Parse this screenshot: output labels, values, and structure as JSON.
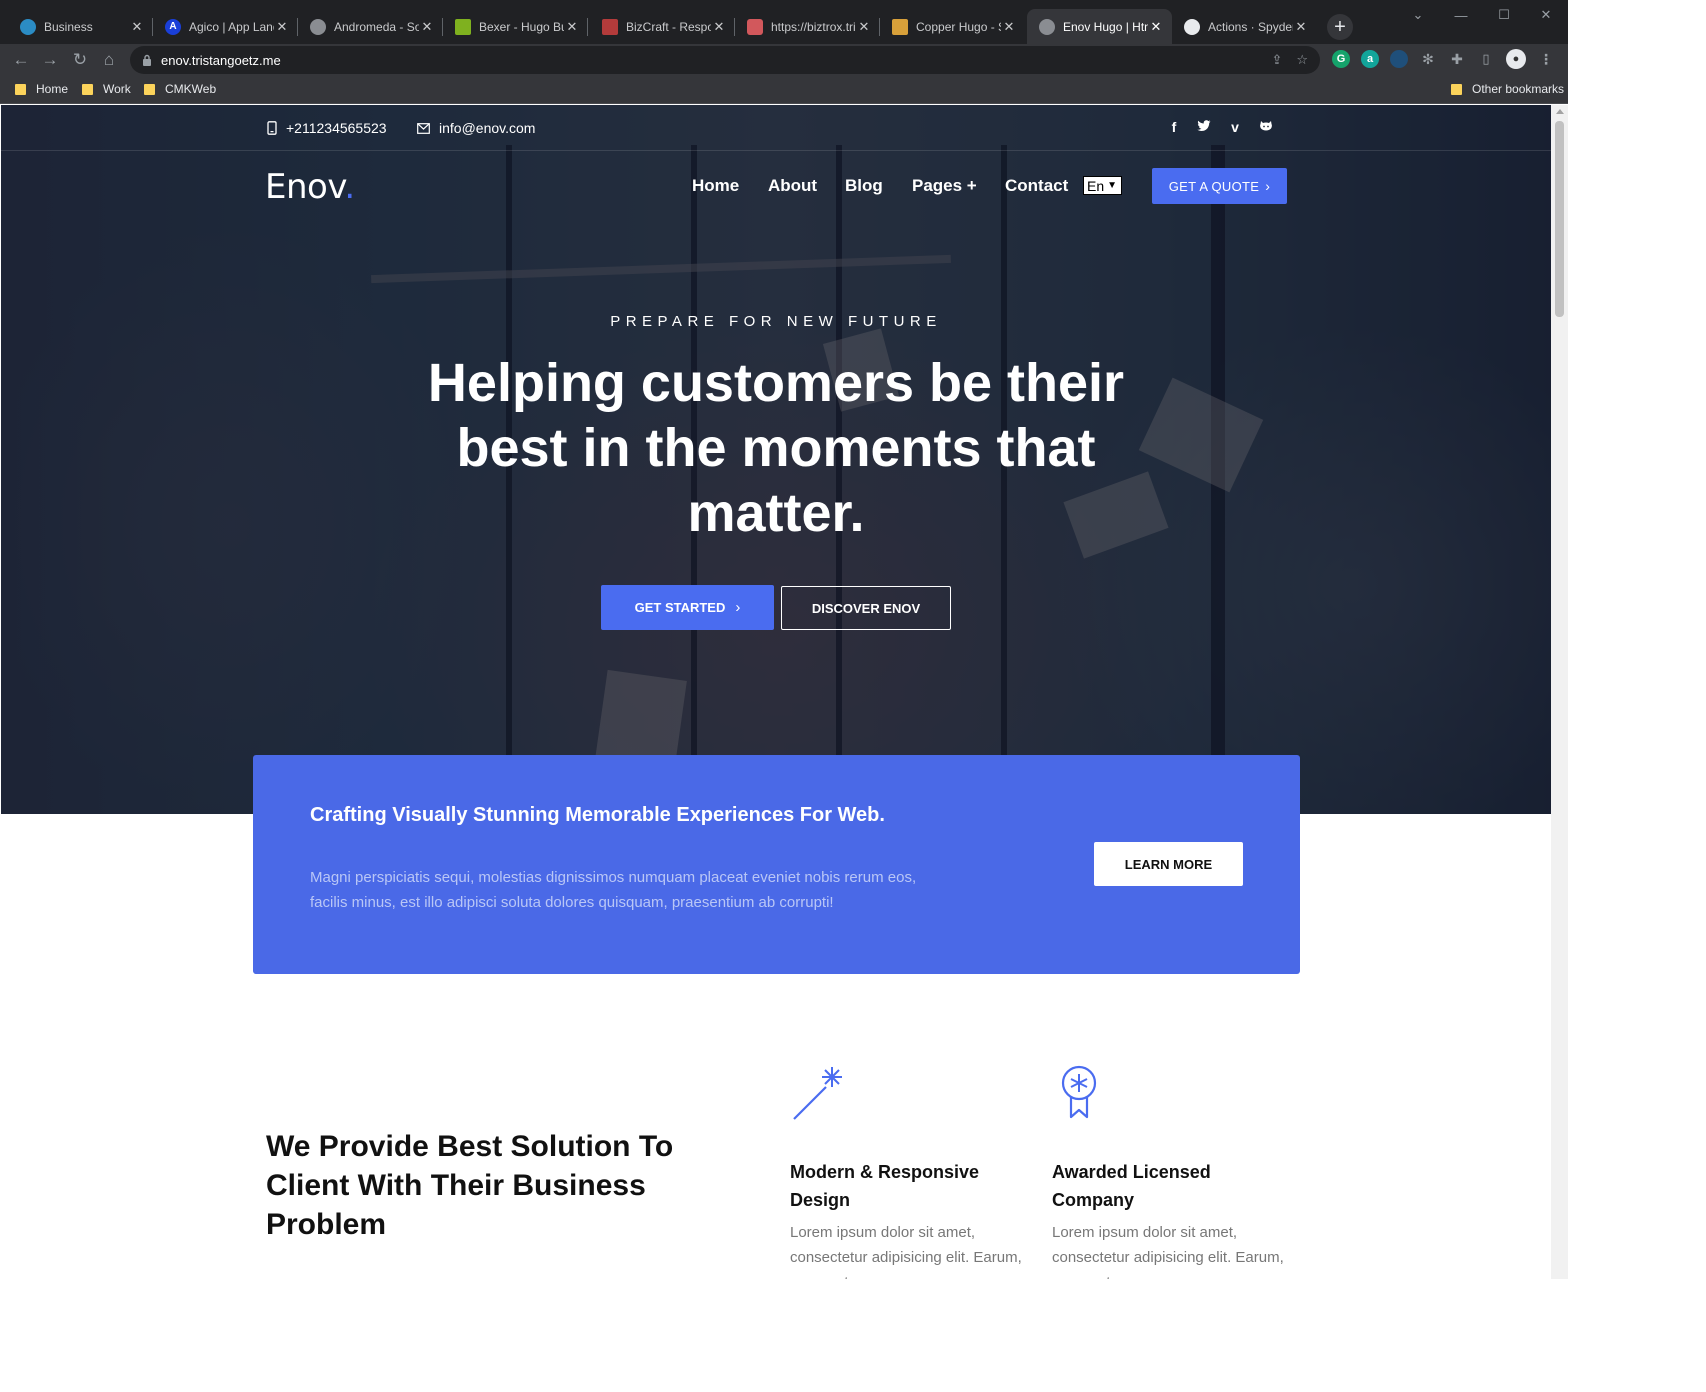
{
  "browser": {
    "tabs": [
      {
        "title": "Business",
        "fav_color": "#2b8cc4",
        "fav_glyph": ""
      },
      {
        "title": "Agico | App Landi",
        "fav_color": "#1a3fd8",
        "fav_glyph": "A"
      },
      {
        "title": "Andromeda - Sof",
        "fav_color": "#8a8d92",
        "fav_glyph": ""
      },
      {
        "title": "Bexer - Hugo Bus",
        "fav_color": "#7fb11f",
        "fav_glyph": ""
      },
      {
        "title": "BizCraft - Respon",
        "fav_color": "#b33b3b",
        "fav_glyph": ""
      },
      {
        "title": "https://biztrox.tri",
        "fav_color": "#d2585c",
        "fav_glyph": ""
      },
      {
        "title": "Copper Hugo - S",
        "fav_color": "#d8a03a",
        "fav_glyph": ""
      },
      {
        "title": "Enov Hugo | Htm",
        "fav_color": "#8a8d92",
        "fav_glyph": ""
      },
      {
        "title": "Actions · SpyderH",
        "fav_color": "#e8eaed",
        "fav_glyph": ""
      }
    ],
    "active_tab": 7,
    "url": "enov.tristangoetz.me",
    "bookmarks": [
      "Home",
      "Work",
      "CMKWeb"
    ],
    "other_bookmarks": "Other bookmarks"
  },
  "topbar": {
    "phone": "+211234565523",
    "email": "info@enov.com",
    "social": [
      "facebook-icon",
      "twitter-icon",
      "vimeo-icon",
      "github-icon"
    ]
  },
  "header": {
    "logo": "Enov",
    "logo_dot": ".",
    "nav": [
      "Home",
      "About",
      "Blog",
      "Pages +",
      "Contact"
    ],
    "language": "En",
    "quote_button": "GET A QUOTE"
  },
  "hero": {
    "kicker": "PREPARE FOR NEW FUTURE",
    "headline": "Helping customers be their best in the moments that matter.",
    "primary_button": "GET STARTED",
    "secondary_button": "DISCOVER ENOV"
  },
  "cta": {
    "title": "Crafting Visually Stunning Memorable Experiences For Web.",
    "text": "Magni perspiciatis sequi, molestias dignissimos numquam placeat eveniet nobis rerum eos, facilis minus, est illo adipisci soluta dolores quisquam, praesentium ab corrupti!",
    "button": "LEARN MORE"
  },
  "solutions": {
    "heading": "We Provide Best Solution To Client With Their Business Problem",
    "features": [
      {
        "icon": "magic-wand-icon",
        "title": "Modern & Responsive Design",
        "text": "Lorem ipsum dolor sit amet, consectetur adipisicing elit. Earum, aspernatur."
      },
      {
        "icon": "award-icon",
        "title": "Awarded Licensed Company",
        "text": "Lorem ipsum dolor sit amet, consectetur adipisicing elit. Earum, aspernatur."
      }
    ]
  },
  "colors": {
    "accent": "#4a6cf0",
    "cta_bg": "#4a69e7"
  }
}
